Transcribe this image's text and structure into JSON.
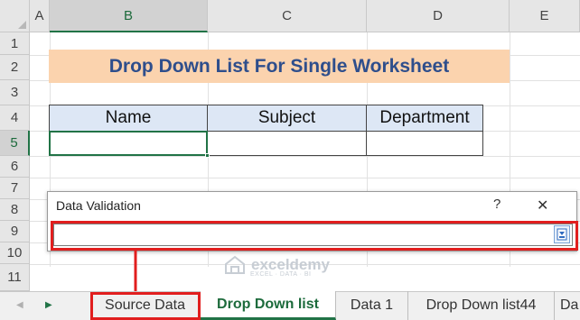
{
  "columns": [
    "A",
    "B",
    "C",
    "D",
    "E"
  ],
  "rows": [
    "1",
    "2",
    "3",
    "4",
    "5",
    "6",
    "7",
    "8",
    "9",
    "10",
    "11"
  ],
  "selected_column": "B",
  "selected_row": "5",
  "title": "Drop Down List For Single Worksheet",
  "table": {
    "headers": [
      "Name",
      "Subject",
      "Department"
    ]
  },
  "dialog": {
    "title": "Data Validation",
    "help": "?",
    "close": "✕",
    "input_value": ""
  },
  "sheet_tabs": [
    {
      "label": "Source Data",
      "active": false
    },
    {
      "label": "Drop Down list",
      "active": true
    },
    {
      "label": "Data 1",
      "active": false
    },
    {
      "label": "Drop Down list44",
      "active": false
    },
    {
      "label": "Da",
      "active": false
    }
  ],
  "watermark": {
    "name": "exceldemy",
    "tagline": "EXCEL · DATA · BI"
  },
  "colors": {
    "accent_green": "#217346",
    "title_fill": "#fbd3ae",
    "title_text": "#2e4e8c",
    "header_fill": "#dde7f5",
    "highlight_red": "#e11e1e"
  }
}
